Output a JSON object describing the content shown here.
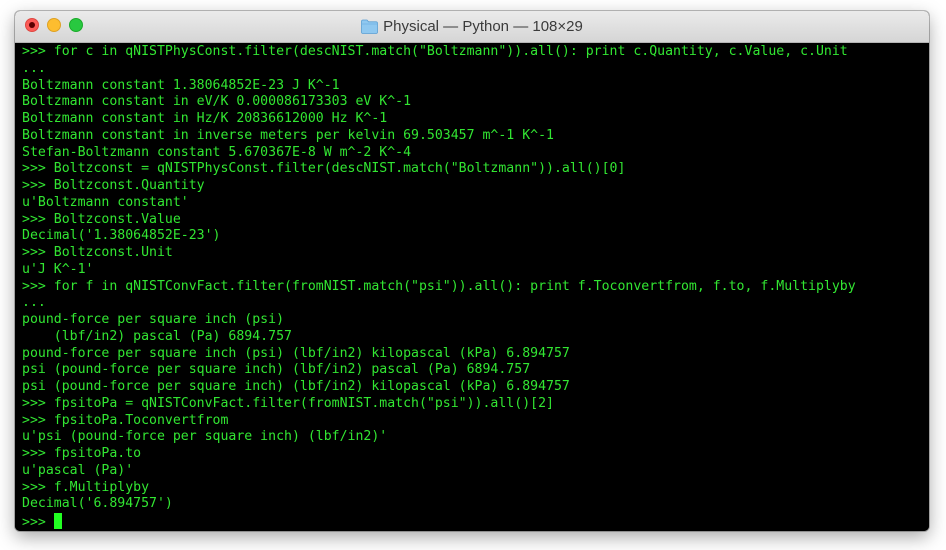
{
  "window": {
    "title": "Physical — Python — 108×29",
    "folder_icon": "folder-icon",
    "text_color": "#32e632",
    "background_color": "#000000"
  },
  "terminal": {
    "lines": [
      ">>> for c in qNISTPhysConst.filter(descNIST.match(\"Boltzmann\")).all(): print c.Quantity, c.Value, c.Unit",
      "...",
      "Boltzmann constant 1.38064852E-23 J K^-1",
      "Boltzmann constant in eV/K 0.000086173303 eV K^-1",
      "Boltzmann constant in Hz/K 20836612000 Hz K^-1",
      "Boltzmann constant in inverse meters per kelvin 69.503457 m^-1 K^-1",
      "Stefan-Boltzmann constant 5.670367E-8 W m^-2 K^-4",
      ">>> Boltzconst = qNISTPhysConst.filter(descNIST.match(\"Boltzmann\")).all()[0]",
      ">>> Boltzconst.Quantity",
      "u'Boltzmann constant'",
      ">>> Boltzconst.Value",
      "Decimal('1.38064852E-23')",
      ">>> Boltzconst.Unit",
      "u'J K^-1'",
      ">>> for f in qNISTConvFact.filter(fromNIST.match(\"psi\")).all(): print f.Toconvertfrom, f.to, f.Multiplyby",
      "...",
      "pound-force per square inch (psi)",
      "    (lbf/in2) pascal (Pa) 6894.757",
      "pound-force per square inch (psi) (lbf/in2) kilopascal (kPa) 6.894757",
      "psi (pound-force per square inch) (lbf/in2) pascal (Pa) 6894.757",
      "psi (pound-force per square inch) (lbf/in2) kilopascal (kPa) 6.894757",
      ">>> fpsitoPa = qNISTConvFact.filter(fromNIST.match(\"psi\")).all()[2]",
      ">>> fpsitoPa.Toconvertfrom",
      "u'psi (pound-force per square inch) (lbf/in2)'",
      ">>> fpsitoPa.to",
      "u'pascal (Pa)'",
      ">>> f.Multiplyby",
      "Decimal('6.894757')"
    ],
    "prompt": ">>>"
  }
}
